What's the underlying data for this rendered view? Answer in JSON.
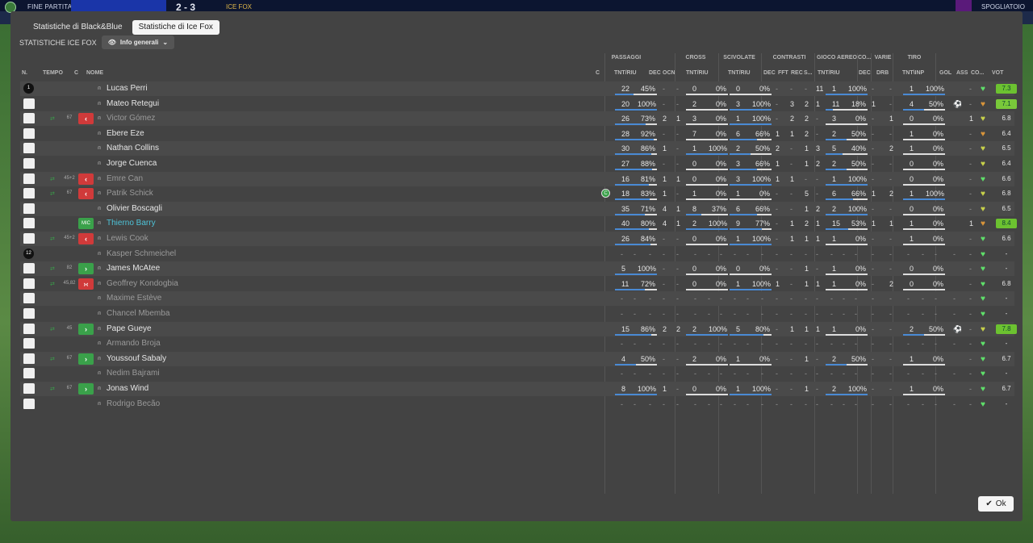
{
  "topbar": {
    "fine": "FINE PARTITA",
    "score": "2 - 3",
    "team2": "ICE FOX",
    "right": "SPOGLIATOIO"
  },
  "tabs": [
    {
      "label": "Statistiche di Black&Blue"
    },
    {
      "label": "Statistiche di Ice Fox"
    }
  ],
  "subheader": {
    "label": "STATISTICHE ICE FOX",
    "dropdown": "Info generali"
  },
  "groups": {
    "passaggi": "PASSAGGI",
    "cross": "CROSS",
    "scivolate": "SCIVOLATE",
    "contrasti": "CONTRASTI",
    "gioco_aereo": "GIOCO AEREO",
    "co": "CO...",
    "varie": "VARIE",
    "tiro": "TIRO"
  },
  "columns": {
    "n": "N.",
    "tempo": "TEMPO",
    "c": "C",
    "nome": "NOME",
    "c2": "C",
    "tnt_riu": "TNT/RIU",
    "dec": "DEC",
    "ocn": "OCN",
    "cross_tnt": "TNT/RIU",
    "sciv_tnt": "TNT/RIU",
    "dec2": "DEC",
    "fft": "FFT",
    "rec": "REC",
    "s": "S...",
    "aereo_tnt": "TNT/RIU",
    "dec3": "DEC",
    "drb": "DRB",
    "tiro_tnt": "TNT\\INP",
    "gol": "GOL",
    "ass": "ASS",
    "co": "CO...",
    "vot": "VOT"
  },
  "players": [
    {
      "num": "1",
      "tempo": "",
      "sub": "",
      "nome": "Lucas Perri",
      "dim": false,
      "pas": "22",
      "pasp": "45%",
      "pasf": 0.45,
      "dec": "-",
      "ocn": "-",
      "cr": "0",
      "crp": "0%",
      "crf": 0,
      "sc": "0",
      "scp": "0%",
      "scf": 0,
      "cdec": "-",
      "fft": "-",
      "rec": "-",
      "s": "11",
      "ae": "1",
      "aep": "100%",
      "aef": 1,
      "adec": "-",
      "drb": "-",
      "ti": "1",
      "tip": "100%",
      "tif": 1,
      "gol": "",
      "ass": "-",
      "heart": "g",
      "vot": "7.3",
      "votc": "g"
    },
    {
      "num": "",
      "tempo": "",
      "sub": "",
      "nome": "Mateo Retegui",
      "dim": false,
      "pas": "20",
      "pasp": "100%",
      "pasf": 1,
      "dec": "-",
      "ocn": "-",
      "cr": "2",
      "crp": "0%",
      "crf": 0,
      "sc": "3",
      "scp": "100%",
      "scf": 1,
      "cdec": "-",
      "fft": "3",
      "rec": "2",
      "s": "1",
      "ae": "11",
      "aep": "18%",
      "aef": 0.18,
      "adec": "1",
      "drb": "-",
      "ti": "4",
      "tip": "50%",
      "tif": 0.5,
      "gol": "⚽",
      "ass": "-",
      "heart": "o",
      "vot": "7.1",
      "votc": "lg"
    },
    {
      "num": "",
      "tempo": "67",
      "sub": "out",
      "nome": "Victor Gómez",
      "dim": true,
      "pas": "26",
      "pasp": "73%",
      "pasf": 0.73,
      "dec": "2",
      "ocn": "1",
      "cr": "3",
      "crp": "0%",
      "crf": 0,
      "sc": "1",
      "scp": "100%",
      "scf": 1,
      "cdec": "-",
      "fft": "2",
      "rec": "2",
      "s": "-",
      "ae": "3",
      "aep": "0%",
      "aef": 0,
      "adec": "-",
      "drb": "1",
      "ti": "0",
      "tip": "0%",
      "tif": 0,
      "gol": "",
      "ass": "1",
      "heart": "y",
      "vot": "6.8",
      "votc": ""
    },
    {
      "num": "",
      "tempo": "",
      "sub": "",
      "nome": "Ebere Eze",
      "dim": false,
      "pas": "28",
      "pasp": "92%",
      "pasf": 0.92,
      "dec": "-",
      "ocn": "-",
      "cr": "7",
      "crp": "0%",
      "crf": 0,
      "sc": "6",
      "scp": "66%",
      "scf": 0.66,
      "cdec": "1",
      "fft": "1",
      "rec": "2",
      "s": "-",
      "ae": "2",
      "aep": "50%",
      "aef": 0.5,
      "adec": "-",
      "drb": "-",
      "ti": "1",
      "tip": "0%",
      "tif": 0,
      "gol": "",
      "ass": "-",
      "heart": "o",
      "vot": "6.4",
      "votc": ""
    },
    {
      "num": "",
      "tempo": "",
      "sub": "",
      "nome": "Nathan Collins",
      "dim": false,
      "pas": "30",
      "pasp": "86%",
      "pasf": 0.86,
      "dec": "1",
      "ocn": "-",
      "cr": "1",
      "crp": "100%",
      "crf": 1,
      "sc": "2",
      "scp": "50%",
      "scf": 0.5,
      "cdec": "2",
      "fft": "-",
      "rec": "1",
      "s": "3",
      "ae": "5",
      "aep": "40%",
      "aef": 0.4,
      "adec": "-",
      "drb": "2",
      "ti": "1",
      "tip": "0%",
      "tif": 0,
      "gol": "",
      "ass": "-",
      "heart": "y",
      "vot": "6.5",
      "votc": ""
    },
    {
      "num": "",
      "tempo": "",
      "sub": "",
      "nome": "Jorge Cuenca",
      "dim": false,
      "pas": "27",
      "pasp": "88%",
      "pasf": 0.88,
      "dec": "-",
      "ocn": "-",
      "cr": "0",
      "crp": "0%",
      "crf": 0,
      "sc": "3",
      "scp": "66%",
      "scf": 0.66,
      "cdec": "1",
      "fft": "-",
      "rec": "1",
      "s": "2",
      "ae": "2",
      "aep": "50%",
      "aef": 0.5,
      "adec": "-",
      "drb": "-",
      "ti": "0",
      "tip": "0%",
      "tif": 0,
      "gol": "",
      "ass": "-",
      "heart": "y",
      "vot": "6.4",
      "votc": ""
    },
    {
      "num": "",
      "tempo": "45+2",
      "sub": "out",
      "nome": "Emre Can",
      "dim": true,
      "pas": "16",
      "pasp": "81%",
      "pasf": 0.81,
      "dec": "1",
      "ocn": "1",
      "cr": "0",
      "crp": "0%",
      "crf": 0,
      "sc": "3",
      "scp": "100%",
      "scf": 1,
      "cdec": "1",
      "fft": "1",
      "rec": "-",
      "s": "-",
      "ae": "1",
      "aep": "100%",
      "aef": 1,
      "adec": "-",
      "drb": "-",
      "ti": "0",
      "tip": "0%",
      "tif": 0,
      "gol": "",
      "ass": "-",
      "heart": "g",
      "vot": "6.6",
      "votc": ""
    },
    {
      "num": "",
      "tempo": "67",
      "sub": "out",
      "nome": "Patrik Schick",
      "dim": true,
      "cap": true,
      "pas": "18",
      "pasp": "83%",
      "pasf": 0.83,
      "dec": "1",
      "ocn": "-",
      "cr": "1",
      "crp": "0%",
      "crf": 0,
      "sc": "1",
      "scp": "0%",
      "scf": 0,
      "cdec": "-",
      "fft": "-",
      "rec": "5",
      "s": "-",
      "ae": "6",
      "aep": "66%",
      "aef": 0.66,
      "adec": "1",
      "drb": "2",
      "ti": "1",
      "tip": "100%",
      "tif": 1,
      "gol": "",
      "ass": "-",
      "heart": "y",
      "vot": "6.8",
      "votc": ""
    },
    {
      "num": "",
      "tempo": "",
      "sub": "",
      "nome": "Olivier Boscagli",
      "dim": false,
      "pas": "35",
      "pasp": "71%",
      "pasf": 0.71,
      "dec": "4",
      "ocn": "1",
      "cr": "8",
      "crp": "37%",
      "crf": 0.37,
      "sc": "6",
      "scp": "66%",
      "scf": 0.66,
      "cdec": "-",
      "fft": "-",
      "rec": "1",
      "s": "2",
      "ae": "2",
      "aep": "100%",
      "aef": 1,
      "adec": "-",
      "drb": "-",
      "ti": "0",
      "tip": "0%",
      "tif": 0,
      "gol": "",
      "ass": "-",
      "heart": "y",
      "vot": "6.5",
      "votc": ""
    },
    {
      "num": "",
      "tempo": "",
      "sub": "mid",
      "nome": "Thierno Barry",
      "dim": false,
      "teal": true,
      "pas": "40",
      "pasp": "80%",
      "pasf": 0.8,
      "dec": "4",
      "ocn": "1",
      "cr": "2",
      "crp": "100%",
      "crf": 1,
      "sc": "9",
      "scp": "77%",
      "scf": 0.77,
      "cdec": "-",
      "fft": "1",
      "rec": "2",
      "s": "1",
      "ae": "15",
      "aep": "53%",
      "aef": 0.53,
      "adec": "1",
      "drb": "1",
      "ti": "1",
      "tip": "0%",
      "tif": 0,
      "gol": "",
      "ass": "1",
      "heart": "o",
      "vot": "8.4",
      "votc": "g"
    },
    {
      "num": "",
      "tempo": "45+2",
      "sub": "out",
      "nome": "Lewis Cook",
      "dim": true,
      "pas": "26",
      "pasp": "84%",
      "pasf": 0.84,
      "dec": "-",
      "ocn": "-",
      "cr": "0",
      "crp": "0%",
      "crf": 0,
      "sc": "1",
      "scp": "100%",
      "scf": 1,
      "cdec": "-",
      "fft": "1",
      "rec": "1",
      "s": "1",
      "ae": "1",
      "aep": "0%",
      "aef": 0,
      "adec": "-",
      "drb": "-",
      "ti": "1",
      "tip": "0%",
      "tif": 0,
      "gol": "",
      "ass": "-",
      "heart": "g",
      "vot": "6.6",
      "votc": ""
    },
    {
      "num": "12",
      "tempo": "",
      "sub": "",
      "nome": "Kasper Schmeichel",
      "dim": true,
      "empty": true,
      "heart": "g",
      "vot": "-",
      "votc": ""
    },
    {
      "num": "",
      "tempo": "82",
      "sub": "in",
      "nome": "James McAtee",
      "dim": false,
      "pas": "5",
      "pasp": "100%",
      "pasf": 1,
      "dec": "-",
      "ocn": "-",
      "cr": "0",
      "crp": "0%",
      "crf": 0,
      "sc": "0",
      "scp": "0%",
      "scf": 0,
      "cdec": "-",
      "fft": "-",
      "rec": "1",
      "s": "-",
      "ae": "1",
      "aep": "0%",
      "aef": 0,
      "adec": "-",
      "drb": "-",
      "ti": "0",
      "tip": "0%",
      "tif": 0,
      "gol": "",
      "ass": "-",
      "heart": "g",
      "vot": "-",
      "votc": ""
    },
    {
      "num": "",
      "tempo": "45,82",
      "sub": "both",
      "nome": "Geoffrey Kondogbia",
      "dim": true,
      "pas": "11",
      "pasp": "72%",
      "pasf": 0.72,
      "dec": "-",
      "ocn": "-",
      "cr": "0",
      "crp": "0%",
      "crf": 0,
      "sc": "1",
      "scp": "100%",
      "scf": 1,
      "cdec": "1",
      "fft": "-",
      "rec": "1",
      "s": "1",
      "ae": "1",
      "aep": "0%",
      "aef": 0,
      "adec": "-",
      "drb": "2",
      "ti": "0",
      "tip": "0%",
      "tif": 0,
      "gol": "",
      "ass": "-",
      "heart": "g",
      "vot": "6.8",
      "votc": ""
    },
    {
      "num": "",
      "tempo": "",
      "sub": "",
      "nome": "Maxime Estève",
      "dim": true,
      "empty": true,
      "heart": "g",
      "vot": "-",
      "votc": ""
    },
    {
      "num": "",
      "tempo": "",
      "sub": "",
      "nome": "Chancel Mbemba",
      "dim": true,
      "empty": true,
      "heart": "g",
      "vot": "-",
      "votc": ""
    },
    {
      "num": "",
      "tempo": "45",
      "sub": "in",
      "nome": "Pape Gueye",
      "dim": false,
      "pas": "15",
      "pasp": "86%",
      "pasf": 0.86,
      "dec": "2",
      "ocn": "2",
      "cr": "2",
      "crp": "100%",
      "crf": 1,
      "sc": "5",
      "scp": "80%",
      "scf": 0.8,
      "cdec": "-",
      "fft": "1",
      "rec": "1",
      "s": "1",
      "ae": "1",
      "aep": "0%",
      "aef": 0,
      "adec": "-",
      "drb": "-",
      "ti": "2",
      "tip": "50%",
      "tif": 0.5,
      "gol": "⚽",
      "ass": "-",
      "heart": "y",
      "vot": "7.8",
      "votc": "g"
    },
    {
      "num": "",
      "tempo": "",
      "sub": "",
      "nome": "Armando Broja",
      "dim": true,
      "empty": true,
      "heart": "g",
      "vot": "-",
      "votc": ""
    },
    {
      "num": "",
      "tempo": "67",
      "sub": "in",
      "nome": "Youssouf Sabaly",
      "dim": false,
      "pas": "4",
      "pasp": "50%",
      "pasf": 0.5,
      "dec": "-",
      "ocn": "-",
      "cr": "2",
      "crp": "0%",
      "crf": 0,
      "sc": "1",
      "scp": "0%",
      "scf": 0,
      "cdec": "-",
      "fft": "-",
      "rec": "1",
      "s": "-",
      "ae": "2",
      "aep": "50%",
      "aef": 0.5,
      "adec": "-",
      "drb": "-",
      "ti": "1",
      "tip": "0%",
      "tif": 0,
      "gol": "",
      "ass": "-",
      "heart": "g",
      "vot": "6.7",
      "votc": ""
    },
    {
      "num": "",
      "tempo": "",
      "sub": "",
      "nome": "Nedim Bajrami",
      "dim": true,
      "empty": true,
      "heart": "g",
      "vot": "-",
      "votc": ""
    },
    {
      "num": "",
      "tempo": "67",
      "sub": "in",
      "nome": "Jonas Wind",
      "dim": false,
      "pas": "8",
      "pasp": "100%",
      "pasf": 1,
      "dec": "1",
      "ocn": "-",
      "cr": "0",
      "crp": "0%",
      "crf": 0,
      "sc": "1",
      "scp": "100%",
      "scf": 1,
      "cdec": "-",
      "fft": "-",
      "rec": "1",
      "s": "-",
      "ae": "2",
      "aep": "100%",
      "aef": 1,
      "adec": "-",
      "drb": "-",
      "ti": "1",
      "tip": "0%",
      "tif": 0,
      "gol": "",
      "ass": "-",
      "heart": "g",
      "vot": "6.7",
      "votc": ""
    },
    {
      "num": "",
      "tempo": "",
      "sub": "",
      "nome": "Rodrigo Becão",
      "dim": true,
      "empty": true,
      "heart": "g",
      "vot": "-",
      "votc": ""
    }
  ],
  "ok": "Ok",
  "mid_label": "MIC"
}
